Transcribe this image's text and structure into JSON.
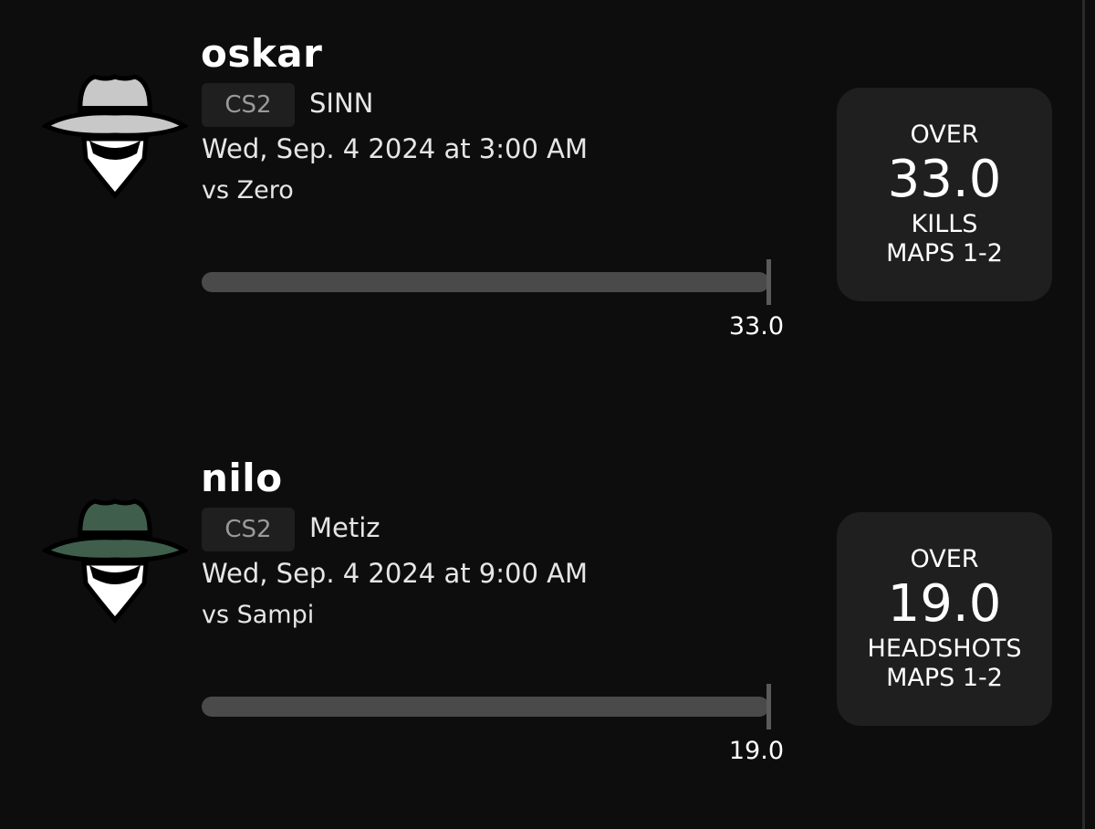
{
  "picks": [
    {
      "player": "oskar",
      "game": "CS2",
      "team": "SINN",
      "time": "Wed, Sep. 4 2024 at 3:00 AM",
      "opponent": "vs Zero",
      "bar_value": "33.0",
      "direction": "OVER",
      "line": "33.0",
      "stat": "KILLS",
      "maps": "MAPS 1-2",
      "hat_color": "#c8c8c8",
      "avatar_icon": "spy-icon"
    },
    {
      "player": "nilo",
      "game": "CS2",
      "team": "Metiz",
      "time": "Wed, Sep. 4 2024 at 9:00 AM",
      "opponent": "vs Sampi",
      "bar_value": "19.0",
      "direction": "OVER",
      "line": "19.0",
      "stat": "HEADSHOTS",
      "maps": "MAPS 1-2",
      "hat_color": "#3f5f4c",
      "avatar_icon": "spy-icon"
    }
  ]
}
